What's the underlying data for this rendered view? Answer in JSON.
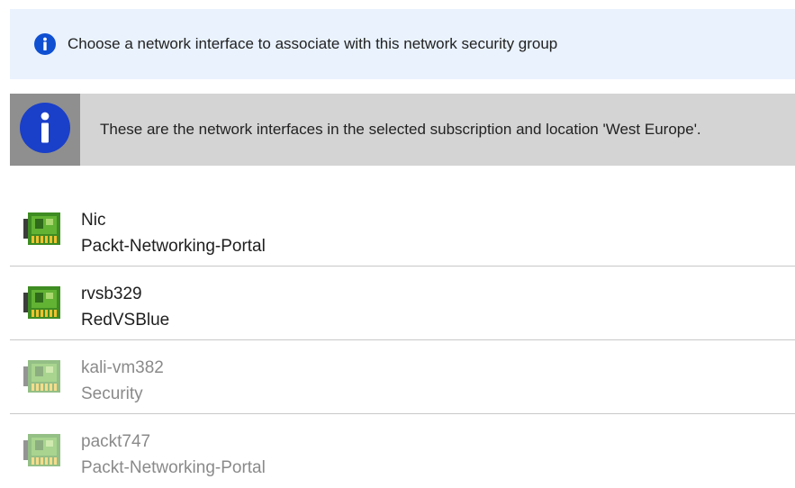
{
  "banner": {
    "icon": "info-icon",
    "text": "Choose a network interface to associate with this network security group",
    "accent": "#0f4fd1"
  },
  "notice": {
    "icon": "info-icon",
    "text": "These are the network interfaces in the selected subscription and location 'West Europe'."
  },
  "interfaces": [
    {
      "name": "Nic",
      "group": "Packt-Networking-Portal",
      "icon": "network-interface-icon",
      "enabled": true
    },
    {
      "name": "rvsb329",
      "group": "RedVSBlue",
      "icon": "network-interface-icon",
      "enabled": true
    },
    {
      "name": "kali-vm382",
      "group": "Security",
      "icon": "network-interface-icon",
      "enabled": false
    },
    {
      "name": "packt747",
      "group": "Packt-Networking-Portal",
      "icon": "network-interface-icon",
      "enabled": false
    }
  ]
}
